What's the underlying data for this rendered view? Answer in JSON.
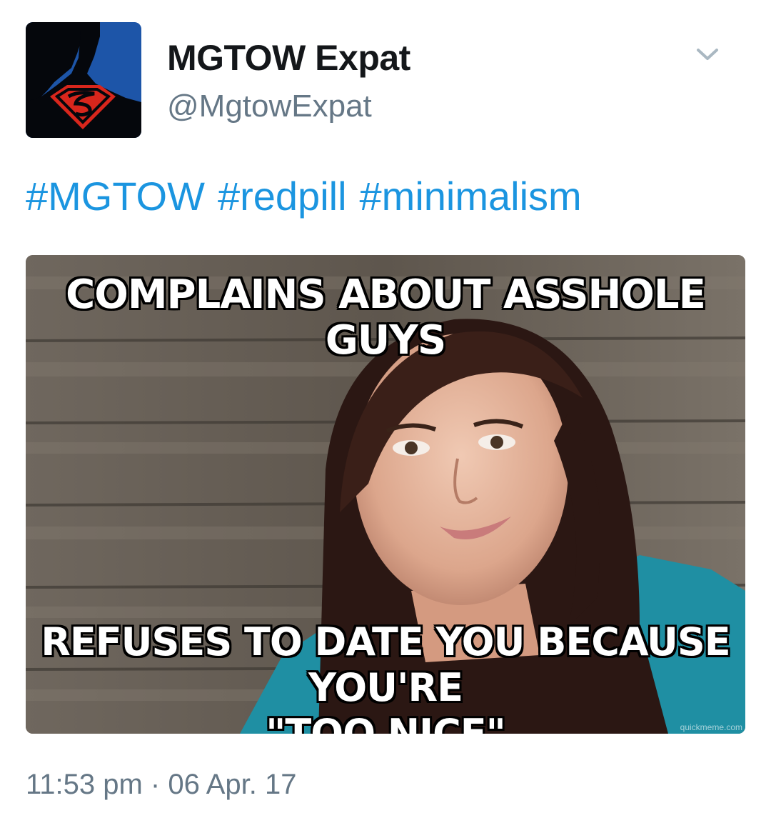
{
  "author": {
    "display_name": "MGTOW Expat",
    "handle": "@MgtowExpat",
    "avatar_icon": "superman-shield-avatar"
  },
  "menu": {
    "icon": "chevron-down-icon"
  },
  "tweet": {
    "hashtags": [
      "#MGTOW",
      "#redpill",
      "#minimalism"
    ],
    "media": {
      "top_text": "COMPLAINS ABOUT ASSHOLE GUYS",
      "bottom_text_line1": "REFUSES TO DATE YOU BECAUSE YOU'RE",
      "bottom_text_line2": "\"TOO NICE\"",
      "watermark": "quickmeme.com"
    },
    "timestamp": "11:53 pm · 06 Apr. 17"
  },
  "colors": {
    "link": "#1b95e0",
    "secondary_text": "#657786",
    "primary_text": "#14171a"
  }
}
